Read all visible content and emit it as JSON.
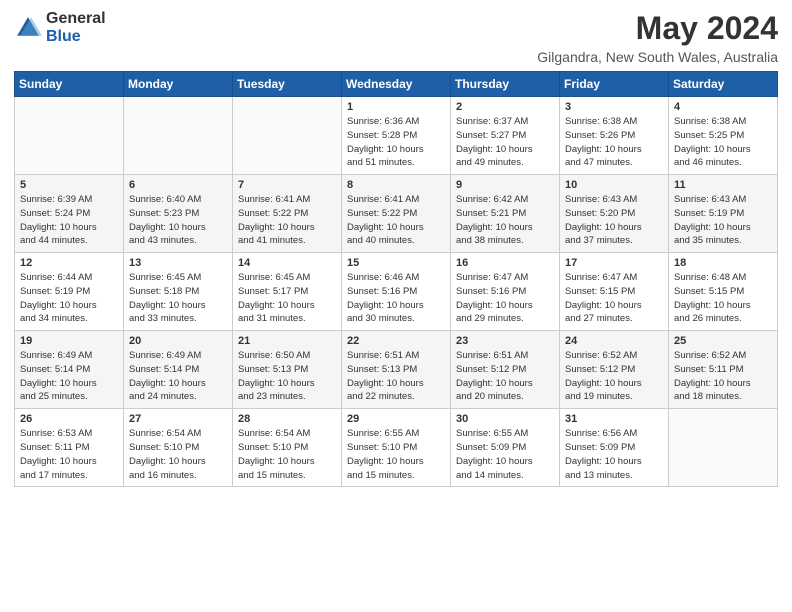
{
  "logo": {
    "general": "General",
    "blue": "Blue"
  },
  "title": "May 2024",
  "subtitle": "Gilgandra, New South Wales, Australia",
  "days_of_week": [
    "Sunday",
    "Monday",
    "Tuesday",
    "Wednesday",
    "Thursday",
    "Friday",
    "Saturday"
  ],
  "weeks": [
    [
      {
        "day": "",
        "info": ""
      },
      {
        "day": "",
        "info": ""
      },
      {
        "day": "",
        "info": ""
      },
      {
        "day": "1",
        "info": "Sunrise: 6:36 AM\nSunset: 5:28 PM\nDaylight: 10 hours\nand 51 minutes."
      },
      {
        "day": "2",
        "info": "Sunrise: 6:37 AM\nSunset: 5:27 PM\nDaylight: 10 hours\nand 49 minutes."
      },
      {
        "day": "3",
        "info": "Sunrise: 6:38 AM\nSunset: 5:26 PM\nDaylight: 10 hours\nand 47 minutes."
      },
      {
        "day": "4",
        "info": "Sunrise: 6:38 AM\nSunset: 5:25 PM\nDaylight: 10 hours\nand 46 minutes."
      }
    ],
    [
      {
        "day": "5",
        "info": "Sunrise: 6:39 AM\nSunset: 5:24 PM\nDaylight: 10 hours\nand 44 minutes."
      },
      {
        "day": "6",
        "info": "Sunrise: 6:40 AM\nSunset: 5:23 PM\nDaylight: 10 hours\nand 43 minutes."
      },
      {
        "day": "7",
        "info": "Sunrise: 6:41 AM\nSunset: 5:22 PM\nDaylight: 10 hours\nand 41 minutes."
      },
      {
        "day": "8",
        "info": "Sunrise: 6:41 AM\nSunset: 5:22 PM\nDaylight: 10 hours\nand 40 minutes."
      },
      {
        "day": "9",
        "info": "Sunrise: 6:42 AM\nSunset: 5:21 PM\nDaylight: 10 hours\nand 38 minutes."
      },
      {
        "day": "10",
        "info": "Sunrise: 6:43 AM\nSunset: 5:20 PM\nDaylight: 10 hours\nand 37 minutes."
      },
      {
        "day": "11",
        "info": "Sunrise: 6:43 AM\nSunset: 5:19 PM\nDaylight: 10 hours\nand 35 minutes."
      }
    ],
    [
      {
        "day": "12",
        "info": "Sunrise: 6:44 AM\nSunset: 5:19 PM\nDaylight: 10 hours\nand 34 minutes."
      },
      {
        "day": "13",
        "info": "Sunrise: 6:45 AM\nSunset: 5:18 PM\nDaylight: 10 hours\nand 33 minutes."
      },
      {
        "day": "14",
        "info": "Sunrise: 6:45 AM\nSunset: 5:17 PM\nDaylight: 10 hours\nand 31 minutes."
      },
      {
        "day": "15",
        "info": "Sunrise: 6:46 AM\nSunset: 5:16 PM\nDaylight: 10 hours\nand 30 minutes."
      },
      {
        "day": "16",
        "info": "Sunrise: 6:47 AM\nSunset: 5:16 PM\nDaylight: 10 hours\nand 29 minutes."
      },
      {
        "day": "17",
        "info": "Sunrise: 6:47 AM\nSunset: 5:15 PM\nDaylight: 10 hours\nand 27 minutes."
      },
      {
        "day": "18",
        "info": "Sunrise: 6:48 AM\nSunset: 5:15 PM\nDaylight: 10 hours\nand 26 minutes."
      }
    ],
    [
      {
        "day": "19",
        "info": "Sunrise: 6:49 AM\nSunset: 5:14 PM\nDaylight: 10 hours\nand 25 minutes."
      },
      {
        "day": "20",
        "info": "Sunrise: 6:49 AM\nSunset: 5:14 PM\nDaylight: 10 hours\nand 24 minutes."
      },
      {
        "day": "21",
        "info": "Sunrise: 6:50 AM\nSunset: 5:13 PM\nDaylight: 10 hours\nand 23 minutes."
      },
      {
        "day": "22",
        "info": "Sunrise: 6:51 AM\nSunset: 5:13 PM\nDaylight: 10 hours\nand 22 minutes."
      },
      {
        "day": "23",
        "info": "Sunrise: 6:51 AM\nSunset: 5:12 PM\nDaylight: 10 hours\nand 20 minutes."
      },
      {
        "day": "24",
        "info": "Sunrise: 6:52 AM\nSunset: 5:12 PM\nDaylight: 10 hours\nand 19 minutes."
      },
      {
        "day": "25",
        "info": "Sunrise: 6:52 AM\nSunset: 5:11 PM\nDaylight: 10 hours\nand 18 minutes."
      }
    ],
    [
      {
        "day": "26",
        "info": "Sunrise: 6:53 AM\nSunset: 5:11 PM\nDaylight: 10 hours\nand 17 minutes."
      },
      {
        "day": "27",
        "info": "Sunrise: 6:54 AM\nSunset: 5:10 PM\nDaylight: 10 hours\nand 16 minutes."
      },
      {
        "day": "28",
        "info": "Sunrise: 6:54 AM\nSunset: 5:10 PM\nDaylight: 10 hours\nand 15 minutes."
      },
      {
        "day": "29",
        "info": "Sunrise: 6:55 AM\nSunset: 5:10 PM\nDaylight: 10 hours\nand 15 minutes."
      },
      {
        "day": "30",
        "info": "Sunrise: 6:55 AM\nSunset: 5:09 PM\nDaylight: 10 hours\nand 14 minutes."
      },
      {
        "day": "31",
        "info": "Sunrise: 6:56 AM\nSunset: 5:09 PM\nDaylight: 10 hours\nand 13 minutes."
      },
      {
        "day": "",
        "info": ""
      }
    ]
  ]
}
